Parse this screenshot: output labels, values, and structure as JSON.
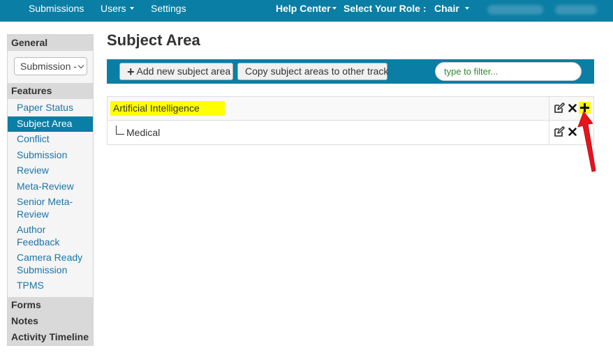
{
  "nav": {
    "submissions": "Submissions",
    "users": "Users",
    "settings": "Settings",
    "help_center": "Help Center",
    "select_role": "Select Your Role :",
    "role": "Chair"
  },
  "sidebar": {
    "general": "General",
    "select_value": "Submission -",
    "features": "Features",
    "items": [
      {
        "label": "Paper Status"
      },
      {
        "label": "Subject Area"
      },
      {
        "label": "Conflict"
      },
      {
        "label": "Submission"
      },
      {
        "label": "Review"
      },
      {
        "label": "Meta-Review"
      },
      {
        "label": "Senior Meta-Review"
      },
      {
        "label": "Author Feedback"
      },
      {
        "label": "Camera Ready Submission"
      },
      {
        "label": "TPMS"
      }
    ],
    "forms": "Forms",
    "notes": "Notes",
    "activity_timeline": "Activity Timeline"
  },
  "main": {
    "title": "Subject Area",
    "add_button": "Add new subject area",
    "copy_button": "Copy subject areas to other track",
    "filter_placeholder": "type to filter...",
    "rows": [
      {
        "label": "Artificial Intelligence"
      },
      {
        "label": "Medical"
      }
    ]
  },
  "icons": {
    "edit": "edit-icon",
    "delete": "close-icon",
    "add_child": "plus-icon",
    "annotation": "red-arrow"
  },
  "colors": {
    "brand": "#0a7ea4",
    "link": "#1a76a8",
    "highlight": "#ffff00",
    "annotation_arrow": "#e8141b",
    "filter_text": "#2c8a2c"
  }
}
